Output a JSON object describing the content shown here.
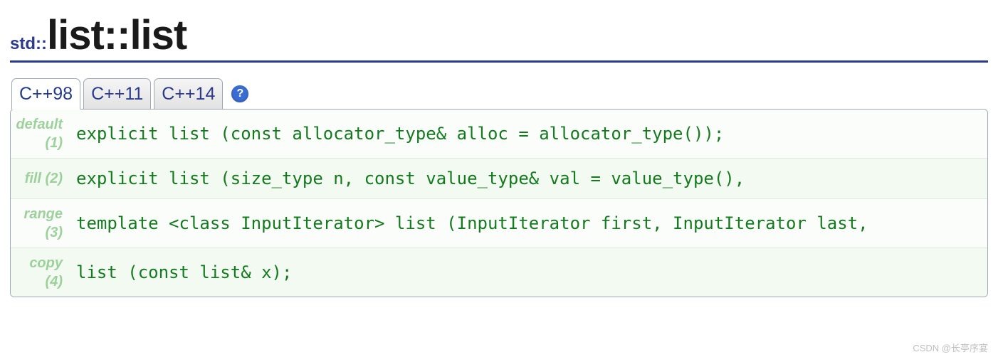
{
  "title": {
    "ns1": "std",
    "sep1": "::",
    "class": "list",
    "sep2": "::",
    "member": "list"
  },
  "tabs": [
    {
      "label": "C++98",
      "active": true
    },
    {
      "label": "C++11",
      "active": false
    },
    {
      "label": "C++14",
      "active": false
    }
  ],
  "help_icon_glyph": "?",
  "overloads": [
    {
      "label": "default (1)",
      "code": "explicit list (const allocator_type& alloc = allocator_type());"
    },
    {
      "label": "fill (2)",
      "code": "explicit list (size_type n, const value_type& val = value_type(),"
    },
    {
      "label": "range (3)",
      "code": "template <class InputIterator>  list (InputIterator first, InputIterator last,"
    },
    {
      "label": "copy (4)",
      "code": "list (const list& x);"
    }
  ],
  "watermark": "CSDN @长亭序宴"
}
